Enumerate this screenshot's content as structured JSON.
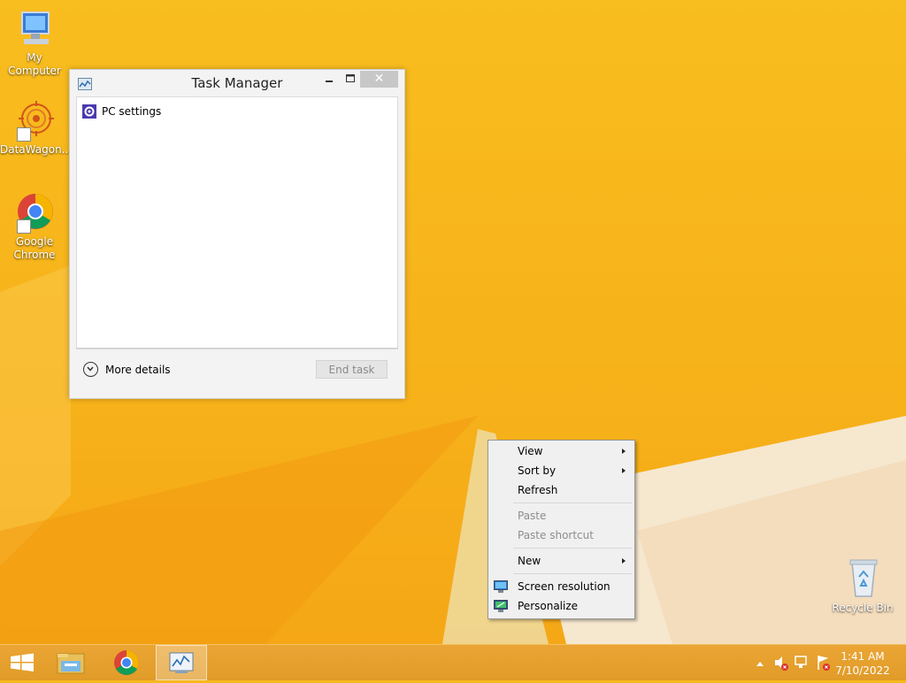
{
  "desktop": {
    "icons": [
      {
        "label": "My Computer"
      },
      {
        "label": "DataWagon..."
      },
      {
        "label": "Google Chrome"
      },
      {
        "label": "Recycle Bin"
      }
    ]
  },
  "task_manager": {
    "title": "Task Manager",
    "items": [
      {
        "label": "PC settings"
      }
    ],
    "more_details": "More details",
    "end_task": "End task",
    "close_glyph": "✕"
  },
  "context_menu": {
    "items": [
      {
        "label": "View",
        "submenu": true,
        "enabled": true
      },
      {
        "label": "Sort by",
        "submenu": true,
        "enabled": true
      },
      {
        "label": "Refresh",
        "enabled": true
      },
      {
        "label": "Paste",
        "enabled": false
      },
      {
        "label": "Paste shortcut",
        "enabled": false
      },
      {
        "label": "New",
        "submenu": true,
        "enabled": true
      },
      {
        "label": "Screen resolution",
        "icon": "monitor-icon",
        "enabled": true
      },
      {
        "label": "Personalize",
        "icon": "personalize-icon",
        "enabled": true
      }
    ]
  },
  "taskbar": {
    "clock_time": "1:41 AM",
    "clock_date": "7/10/2022",
    "colors": {
      "accent": "#f5b01a",
      "taskbar": "#e6a22f"
    }
  }
}
